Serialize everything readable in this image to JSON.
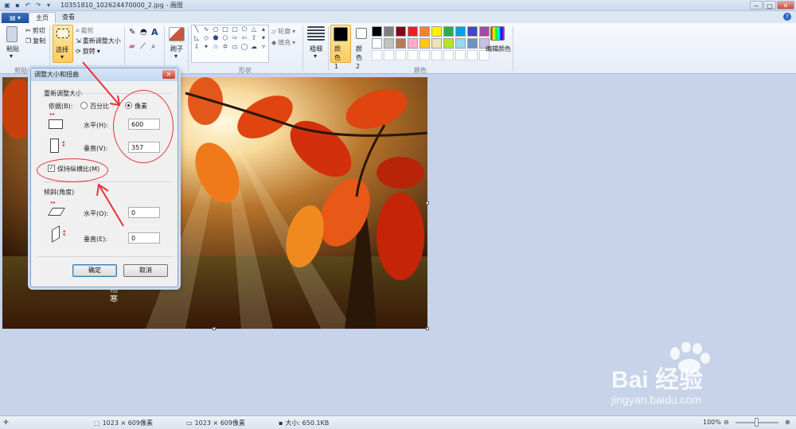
{
  "window": {
    "title": "10351810_102624470000_2.jpg - 画图",
    "controls": [
      "─",
      "□",
      "✕"
    ]
  },
  "quick_access": [
    "save-icon",
    "undo-icon",
    "redo-icon",
    "dropdown-icon"
  ],
  "tabs": [
    {
      "label": "主页",
      "active": true
    },
    {
      "label": "查看",
      "active": false
    }
  ],
  "ribbon": {
    "clipboard": {
      "paste": "粘贴",
      "cut": "剪切",
      "copy": "复制",
      "group": "剪贴板"
    },
    "image": {
      "select": "选择",
      "crop": "裁剪",
      "resize": "重新调整大小",
      "rotate": "旋转",
      "group": "图像"
    },
    "tools": {
      "brush": "刷子",
      "group": "工具"
    },
    "shapes": {
      "outline": "轮廓",
      "fill": "填充",
      "group": "形状"
    },
    "size": {
      "label": "粗细"
    },
    "colors": {
      "color1": "颜色 1",
      "color2": "颜色 2",
      "edit": "编辑颜色",
      "group": "颜色",
      "color1_value": "#000000",
      "color2_value": "#ffffff",
      "palette": [
        "#000000",
        "#7f7f7f",
        "#880015",
        "#ed1c24",
        "#ff7f27",
        "#fff200",
        "#22b14c",
        "#00a2e8",
        "#3f48cc",
        "#a349a4",
        "#ffffff",
        "#c3c3c3",
        "#b97a57",
        "#ffaec9",
        "#ffc90e",
        "#efe4b0",
        "#b5e61d",
        "#99d9ea",
        "#7092be",
        "#c8bfe7",
        "#ffffff",
        "#ffffff",
        "#ffffff",
        "#ffffff",
        "#ffffff",
        "#ffffff",
        "#ffffff",
        "#ffffff",
        "#ffffff",
        "#ffffff"
      ]
    }
  },
  "dialog": {
    "title": "调整大小和扭曲",
    "close": "✕",
    "resize_section": "重新调整大小",
    "by_label": "依据(B):",
    "percent": "百分比",
    "pixels": "像素",
    "horizontal_label": "水平(H):",
    "horizontal_value": "600",
    "vertical_label": "垂直(V):",
    "vertical_value": "357",
    "keep_ratio": "保持纵横比(M)",
    "skew_section": "倾斜(角度)",
    "skew_h_label": "水平(O):",
    "skew_h_value": "0",
    "skew_v_label": "垂直(E):",
    "skew_v_value": "0",
    "ok": "确定",
    "cancel": "取消"
  },
  "statusbar": {
    "selection_size": "1023 × 609像素",
    "image_size": "1023 × 609像素",
    "file_size": "大小: 650.1KB",
    "zoom": "100%"
  },
  "watermark": {
    "brand": "Bai 经验",
    "url": "jingyan.baidu.com"
  },
  "signature": "杨寒"
}
